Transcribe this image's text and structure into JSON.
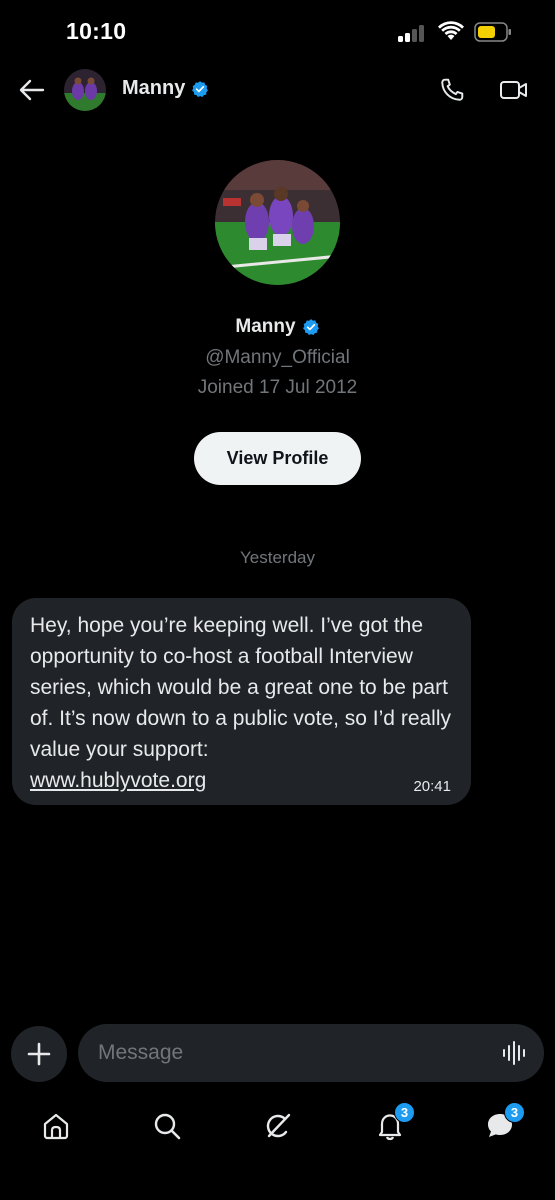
{
  "status_bar": {
    "time": "10:10"
  },
  "header": {
    "name": "Manny"
  },
  "profile": {
    "name": "Manny",
    "handle": "@Manny_Official",
    "joined": "Joined 17 Jul 2012",
    "view_profile_label": "View Profile"
  },
  "conversation": {
    "date_separator": "Yesterday",
    "messages": [
      {
        "text": "Hey, hope you’re keeping well. I’ve got the opportunity to co-host a football Interview series, which would be a great one to be part of. It’s now down to a public vote, so I’d really value your support:",
        "link": "www.hublyvote.org",
        "time": "20:41"
      }
    ]
  },
  "composer": {
    "placeholder": "Message"
  },
  "bottom_nav": {
    "items": [
      {
        "icon": "home-icon"
      },
      {
        "icon": "search-icon"
      },
      {
        "icon": "grok-icon"
      },
      {
        "icon": "notifications-icon",
        "badge": "3"
      },
      {
        "icon": "messages-icon",
        "badge": "3"
      }
    ]
  },
  "colors": {
    "background": "#000000",
    "bubble": "#202327",
    "accent": "#1d9bf0",
    "secondary_text": "#71767b",
    "battery": "#f4d000"
  }
}
